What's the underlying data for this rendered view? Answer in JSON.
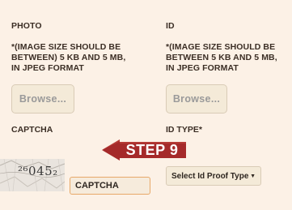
{
  "photo": {
    "title": "PHOTO",
    "instructions": "*(IMAGE SIZE SHOULD BE\nBETWEEN) 5 KB AND 5 MB,\nIN JPEG FORMAT",
    "browse_label": "Browse..."
  },
  "id": {
    "title": "ID",
    "instructions": "*(IMAGE SIZE SHOULD BE\nBETWEEN 5 KB AND 5 MB,\nIN JPEG  FORMAT",
    "browse_label": "Browse..."
  },
  "captcha": {
    "heading": "CAPTCHA",
    "code": "²⁶045₂",
    "input_placeholder": "CAPTCHA"
  },
  "id_type": {
    "heading": "ID TYPE*",
    "selected": "Select Id Proof Type"
  },
  "step_badge": {
    "label": "STEP 9",
    "color": "#a52a2a"
  },
  "colors": {
    "background": "#fcf1e6",
    "input_border": "#e7a868",
    "text": "#3b2e25"
  }
}
